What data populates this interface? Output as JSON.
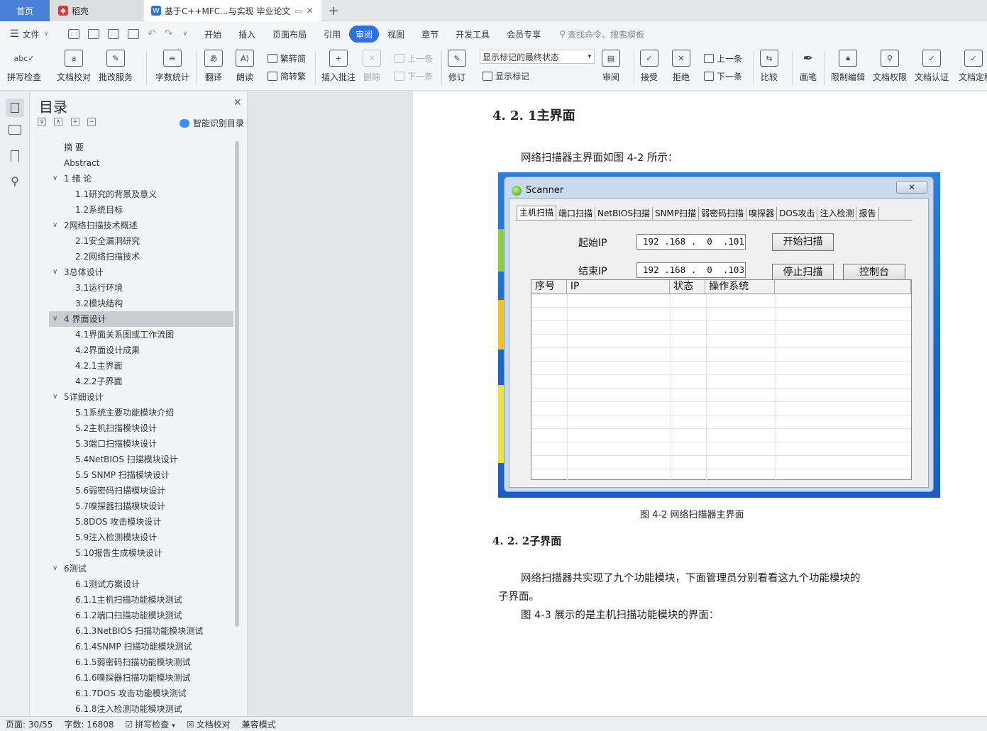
{
  "tabs": {
    "home": "首页",
    "daoke": "稻壳",
    "doc": "基于C++MFC...与实现 毕业论文",
    "add": "+"
  },
  "menu": {
    "file": "文件",
    "items": [
      "开始",
      "插入",
      "页面布局",
      "引用",
      "审阅",
      "视图",
      "章节",
      "开发工具",
      "会员专享"
    ],
    "active": "审阅",
    "search_placeholder": "查找命令、搜索模板"
  },
  "ribbon": {
    "spellcheck": "拼写检查",
    "doc_proof": "文档校对",
    "revise_service": "批改服务",
    "word_count": "字数统计",
    "translate": "翻译",
    "read_aloud": "朗读",
    "to_traditional": "繁转简",
    "to_simplified": "简转繁",
    "insert_comment": "插入批注",
    "delete": "删除",
    "prev": "上一条",
    "next": "下一条",
    "revise": "修订",
    "markup_select": "显示标记的最终状态",
    "show_markup": "显示标记",
    "review": "审阅",
    "accept": "接受",
    "reject": "拒绝",
    "prev2": "上一条",
    "next2": "下一条",
    "compare": "比较",
    "pen": "画笔",
    "restrict_edit": "限制编辑",
    "doc_rights": "文档权限",
    "doc_auth": "文档认证",
    "doc_final": "文档定稿"
  },
  "toc": {
    "title": "目录",
    "smart": "智能识别目录",
    "items": [
      {
        "text": "摘  要",
        "level": 1,
        "caret": ""
      },
      {
        "text": "Abstract",
        "level": 1,
        "caret": ""
      },
      {
        "text": "1  绪 论",
        "level": 1,
        "caret": "∨"
      },
      {
        "text": "1.1研究的背景及意义",
        "level": 2,
        "caret": ""
      },
      {
        "text": "1.2系统目标",
        "level": 2,
        "caret": ""
      },
      {
        "text": "2网络扫描技术概述",
        "level": 1,
        "caret": "∨"
      },
      {
        "text": "2.1安全漏洞研究",
        "level": 2,
        "caret": ""
      },
      {
        "text": "2.2网络扫描技术",
        "level": 2,
        "caret": ""
      },
      {
        "text": "3总体设计",
        "level": 1,
        "caret": "∨"
      },
      {
        "text": "3.1运行环境",
        "level": 2,
        "caret": ""
      },
      {
        "text": "3.2模块结构",
        "level": 2,
        "caret": ""
      },
      {
        "text": "4 界面设计",
        "level": 1,
        "caret": "∨",
        "selected": true
      },
      {
        "text": "4.1界面关系图或工作流图",
        "level": 2,
        "caret": ""
      },
      {
        "text": "4.2界面设计成果",
        "level": 2,
        "caret": ""
      },
      {
        "text": "4.2.1主界面",
        "level": 2,
        "caret": ""
      },
      {
        "text": "4.2.2子界面",
        "level": 2,
        "caret": ""
      },
      {
        "text": "5详细设计",
        "level": 1,
        "caret": "∨"
      },
      {
        "text": "5.1系统主要功能模块介绍",
        "level": 2,
        "caret": ""
      },
      {
        "text": "5.2主机扫描模块设计",
        "level": 2,
        "caret": ""
      },
      {
        "text": "5.3端口扫描模块设计",
        "level": 2,
        "caret": ""
      },
      {
        "text": "5.4NetBIOS 扫描模块设计",
        "level": 2,
        "caret": ""
      },
      {
        "text": "5.5 SNMP 扫描模块设计",
        "level": 2,
        "caret": ""
      },
      {
        "text": "5.6弱密码扫描模块设计",
        "level": 2,
        "caret": ""
      },
      {
        "text": "5.7嗅探器扫描模块设计",
        "level": 2,
        "caret": ""
      },
      {
        "text": "5.8DOS 攻击模块设计",
        "level": 2,
        "caret": ""
      },
      {
        "text": "5.9注入检测模块设计",
        "level": 2,
        "caret": ""
      },
      {
        "text": "5.10报告生成模块设计",
        "level": 2,
        "caret": ""
      },
      {
        "text": "6测试",
        "level": 1,
        "caret": "∨"
      },
      {
        "text": "6.1测试方案设计",
        "level": 2,
        "caret": ""
      },
      {
        "text": "6.1.1主机扫描功能模块测试",
        "level": 2,
        "caret": ""
      },
      {
        "text": "6.1.2端口扫描功能模块测试",
        "level": 2,
        "caret": ""
      },
      {
        "text": "6.1.3NetBIOS 扫描功能模块测试",
        "level": 2,
        "caret": ""
      },
      {
        "text": "6.1.4SNMP 扫描功能模块测试",
        "level": 2,
        "caret": ""
      },
      {
        "text": "6.1.5弱密码扫描功能模块测试",
        "level": 2,
        "caret": ""
      },
      {
        "text": "6.1.6嗅探器扫描功能模块测试",
        "level": 2,
        "caret": ""
      },
      {
        "text": "6.1.7DOS 攻击功能模块测试",
        "level": 2,
        "caret": ""
      },
      {
        "text": "6.1.8注入检测功能模块测试",
        "level": 2,
        "caret": ""
      }
    ]
  },
  "document": {
    "heading1": "4. 2. 1主界面",
    "intro": "网络扫描器主界面如图  4-2 所示：",
    "caption": "图  4-2 网络扫描器主界面",
    "heading2": "4. 2. 2子界面",
    "para1_line1": "网络扫描器共实现了九个功能模块，下面管理员分别看看这九个功能模块的",
    "para1_line2": "子界面。",
    "para2": "图  4-3 展示的是主机扫描功能模块的界面："
  },
  "scanner": {
    "title": "Scanner",
    "close": "✕",
    "tabs": [
      "主机扫描",
      "端口扫描",
      "NetBIOS扫描",
      "SNMP扫描",
      "弱密码扫描",
      "嗅探器",
      "DOS攻击",
      "注入检测",
      "报告"
    ],
    "start_label": "起始IP",
    "end_label": "结束IP",
    "start_ip": "192 .168 .  0  .101",
    "end_ip": "192 .168 .  0  .103",
    "start_btn": "开始扫描",
    "stop_btn": "停止扫描",
    "console_btn": "控制台",
    "columns": [
      "序号",
      "IP",
      "状态",
      "操作系统"
    ]
  },
  "status": {
    "page": "页面: 30/55",
    "words": "字数: 16808",
    "spell": "拼写检查",
    "proof": "文档校对",
    "compat": "兼容模式"
  },
  "colors": {
    "accent": "#2f6fde",
    "home_tab": "#4a7fd6",
    "figure_bg": "#1c66c9"
  }
}
